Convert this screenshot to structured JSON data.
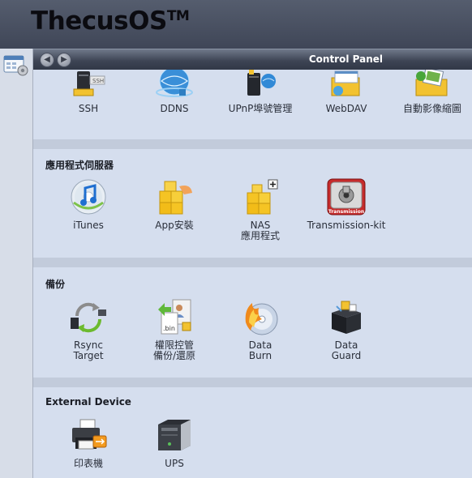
{
  "header": {
    "brand": "ThecusOS",
    "brand_mark": "TM"
  },
  "panel": {
    "title": "Control Panel",
    "back_label": "◀",
    "forward_label": "▶"
  },
  "sections": [
    {
      "title": "",
      "items": [
        {
          "label": "SSH",
          "icon": "ssh-icon"
        },
        {
          "label": "DDNS",
          "icon": "ddns-icon"
        },
        {
          "label": "UPnP埠號管理",
          "icon": "upnp-port-icon"
        },
        {
          "label": "WebDAV",
          "icon": "webdav-icon"
        },
        {
          "label": "自動影像縮圖",
          "icon": "auto-thumbnail-icon"
        }
      ]
    },
    {
      "title": "應用程式伺服器",
      "items": [
        {
          "label": "iTunes",
          "icon": "itunes-icon"
        },
        {
          "label": "App安裝",
          "icon": "app-install-icon"
        },
        {
          "label": "NAS\n應用程式",
          "label1": "NAS",
          "label2": "應用程式",
          "icon": "nas-app-icon"
        },
        {
          "label": "Transmission-kit",
          "icon": "transmission-icon"
        }
      ]
    },
    {
      "title": "備份",
      "items": [
        {
          "label1": "Rsync",
          "label2": "Target",
          "icon": "rsync-icon"
        },
        {
          "label1": "權限控管",
          "label2": "備份/還原",
          "icon": "acl-backup-icon"
        },
        {
          "label1": "Data",
          "label2": "Burn",
          "icon": "data-burn-icon"
        },
        {
          "label1": "Data",
          "label2": "Guard",
          "icon": "data-guard-icon"
        }
      ]
    },
    {
      "title": "External Device",
      "items": [
        {
          "label": "印表機",
          "icon": "printer-icon"
        },
        {
          "label": "UPS",
          "icon": "ups-icon"
        }
      ]
    }
  ],
  "colors": {
    "header_bg": "#4a5162",
    "content_bg": "#d5deee",
    "divider_bg": "#c2cbdb",
    "titlebar_bg": "#3d4454"
  }
}
